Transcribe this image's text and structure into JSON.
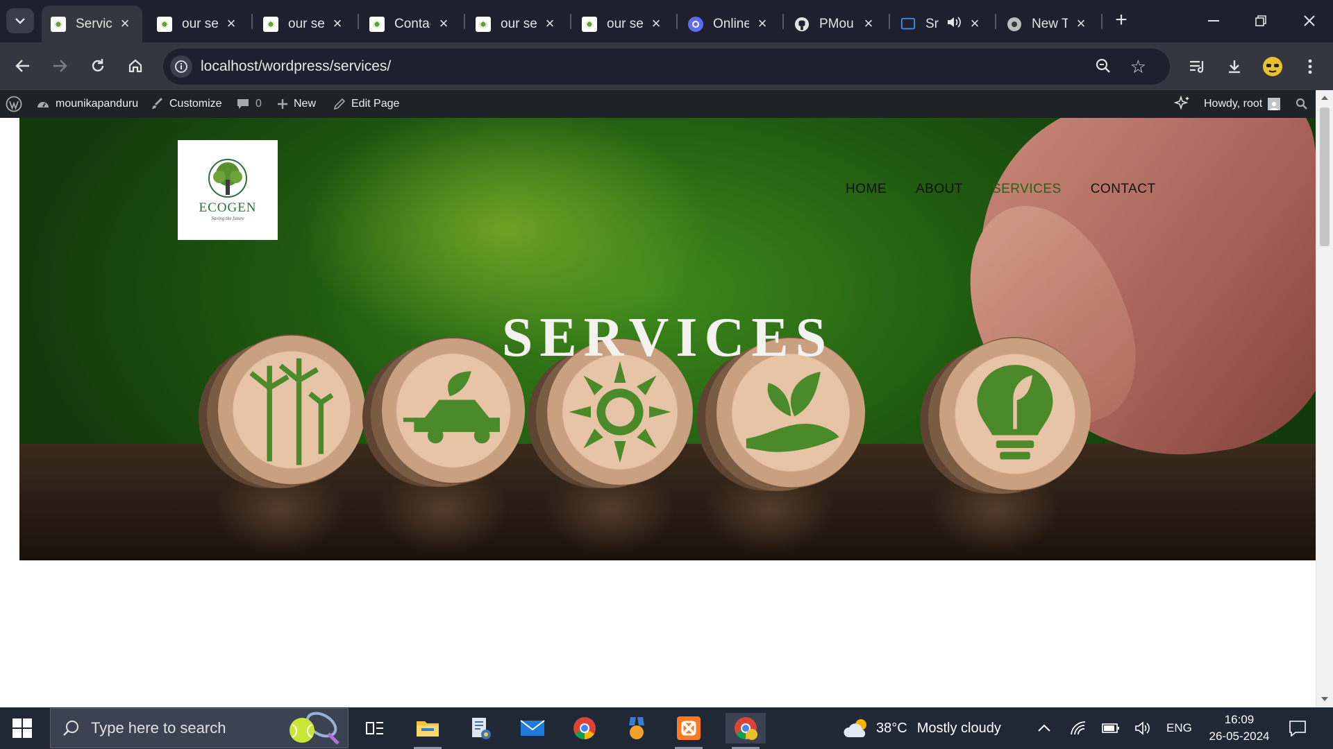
{
  "browser": {
    "tabs": [
      {
        "title": "Services",
        "favicon": "ecogen-icon",
        "active": true
      },
      {
        "title": "our services",
        "favicon": "ecogen-icon"
      },
      {
        "title": "our services",
        "favicon": "ecogen-icon"
      },
      {
        "title": "Contact",
        "favicon": "ecogen-icon"
      },
      {
        "title": "our services",
        "favicon": "ecogen-icon"
      },
      {
        "title": "our services",
        "favicon": "ecogen-icon"
      },
      {
        "title": "Online",
        "favicon": "sync-icon"
      },
      {
        "title": "PMou",
        "favicon": "github-icon"
      },
      {
        "title": "Sr",
        "favicon": "screen-icon",
        "audio": true
      },
      {
        "title": "New Tab",
        "favicon": "chrome-icon"
      }
    ],
    "url": "localhost/wordpress/services/"
  },
  "adminbar": {
    "site_name": "mounikapanduru",
    "customize": "Customize",
    "comments_count": "0",
    "new": "New",
    "edit_page": "Edit Page",
    "howdy": "Howdy, root"
  },
  "site": {
    "logo_name": "ECOGEN",
    "logo_tagline": "Saving the future",
    "nav": [
      "HOME",
      "ABOUT",
      "SERVICES",
      "CONTACT"
    ],
    "current_nav": "SERVICES",
    "hero_title": "SERVICES"
  },
  "taskbar": {
    "search_placeholder": "Type here to search",
    "weather_temp": "38°C",
    "weather_desc": "Mostly cloudy",
    "language": "ENG",
    "time": "16:09",
    "date": "26-05-2024"
  },
  "colors": {
    "tab_bg": "#1f1f2d",
    "toolbar_bg": "#35363f",
    "adminbar_bg": "#1d2327",
    "hero_green": "#3f8a1c",
    "taskbar_bg": "#202836"
  }
}
